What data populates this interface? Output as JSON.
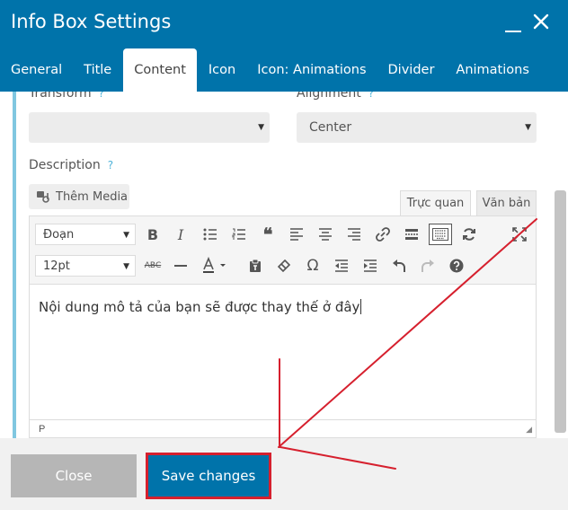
{
  "dialog": {
    "title": "Info Box Settings"
  },
  "tabs": [
    {
      "label": "General"
    },
    {
      "label": "Title"
    },
    {
      "label": "Content",
      "active": true
    },
    {
      "label": "Icon"
    },
    {
      "label": "Icon: Animations"
    },
    {
      "label": "Divider"
    },
    {
      "label": "Animations"
    }
  ],
  "fields": {
    "transform_label": "Transform",
    "transform_value": "",
    "alignment_label": "Alignment",
    "alignment_value": "Center",
    "description_label": "Description",
    "help_glyph": "?"
  },
  "editor": {
    "add_media_label": "Thêm Media",
    "tab_visual": "Trực quan",
    "tab_text": "Văn bản",
    "format_select": "Đoạn",
    "size_select": "12pt",
    "strikethrough_glyph": "ABC",
    "content": "Nội dung mô tả của bạn sẽ được thay thế ở đây",
    "status_path": "P"
  },
  "footer": {
    "close_label": "Close",
    "save_label": "Save changes"
  },
  "colors": {
    "header": "#0073aa",
    "accent_bar": "#80c7e0",
    "annotation": "#d6202e"
  }
}
